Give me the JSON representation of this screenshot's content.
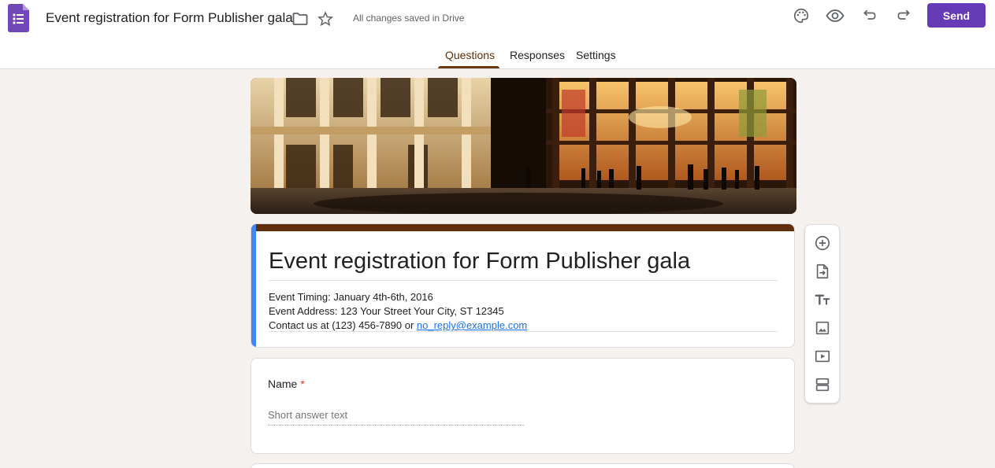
{
  "header": {
    "doc_title": "Event registration for Form Publisher gala",
    "save_status": "All changes saved in Drive",
    "send_label": "Send",
    "icons": [
      "forms-app-icon",
      "folder-icon",
      "star-icon",
      "palette-icon",
      "preview-eye-icon",
      "undo-icon",
      "redo-icon"
    ]
  },
  "tabs": [
    {
      "label": "Questions",
      "active": true
    },
    {
      "label": "Responses",
      "active": false
    },
    {
      "label": "Settings",
      "active": false
    }
  ],
  "form": {
    "title": "Event registration for Form Publisher gala",
    "description_lines": [
      "Event Timing: January 4th-6th, 2016",
      "Event Address: 123 Your Street Your City, ST 12345"
    ],
    "contact_prefix": "Contact us at (123) 456-7890 or ",
    "contact_email": "no_reply@example.com"
  },
  "questions": [
    {
      "title": "Name",
      "required_mark": "*",
      "answer_placeholder": "Short answer text"
    }
  ],
  "side_toolbar": [
    "add-question-icon",
    "import-questions-icon",
    "add-title-text-icon",
    "add-image-icon",
    "add-video-icon",
    "add-section-icon"
  ],
  "colors": {
    "accent": "#673ab7",
    "theme_header": "#5e2f0a",
    "active_tab": "#6b3a10",
    "background": "#f4f1ee",
    "left_accent": "#4285f4",
    "required": "#d93025"
  }
}
